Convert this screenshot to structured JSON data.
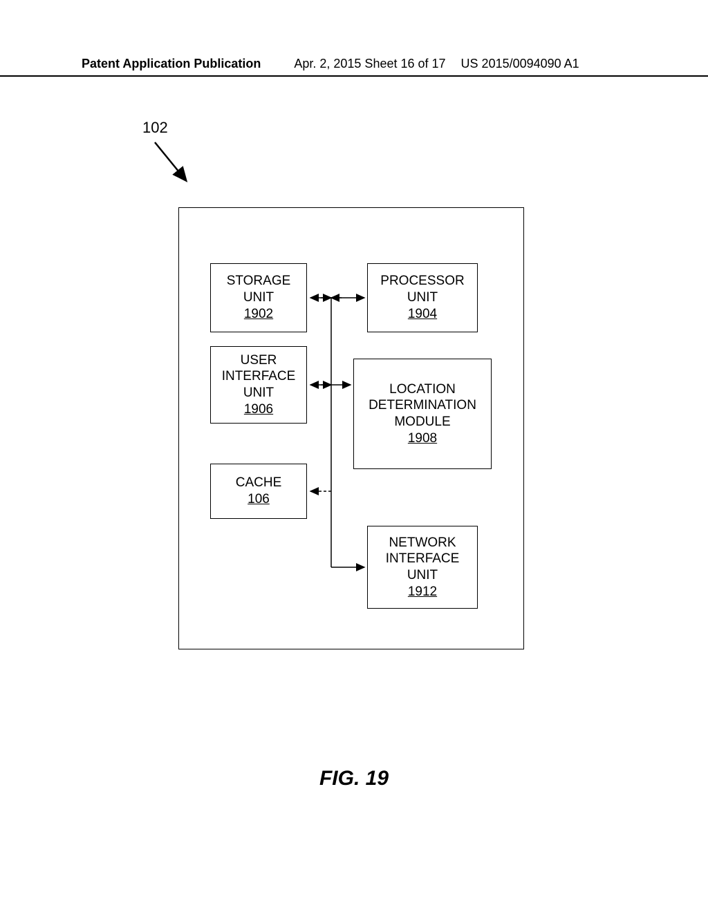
{
  "header": {
    "left": "Patent Application Publication",
    "center": "Apr. 2, 2015  Sheet 16 of 17",
    "right": "US 2015/0094090 A1"
  },
  "reference": "102",
  "blocks": {
    "storage": {
      "lines": [
        "STORAGE",
        "UNIT"
      ],
      "ref": "1902"
    },
    "processor": {
      "lines": [
        "PROCESSOR",
        "UNIT"
      ],
      "ref": "1904"
    },
    "ui": {
      "lines": [
        "USER",
        "INTERFACE",
        "UNIT"
      ],
      "ref": "1906"
    },
    "location": {
      "lines": [
        "LOCATION",
        "DETERMINATION",
        "MODULE"
      ],
      "ref": "1908"
    },
    "cache": {
      "lines": [
        "CACHE"
      ],
      "ref": "106"
    },
    "network": {
      "lines": [
        "NETWORK",
        "INTERFACE",
        "UNIT"
      ],
      "ref": "1912"
    }
  },
  "figure_caption": "FIG. 19"
}
